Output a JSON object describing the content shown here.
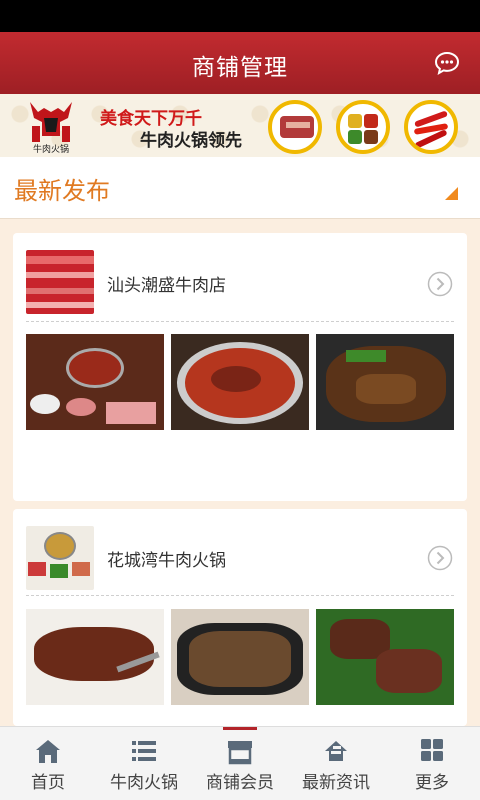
{
  "header": {
    "title": "商铺管理",
    "chat_icon": "chat-bubble-icon"
  },
  "banner": {
    "line1": "美食天下万千",
    "line2": "牛肉火锅领先",
    "logo_text": "牛肉火锅"
  },
  "section": {
    "title": "最新发布"
  },
  "stores": [
    {
      "name": "汕头潮盛牛肉店"
    },
    {
      "name": "花城湾牛肉火锅"
    }
  ],
  "tabbar": {
    "items": [
      {
        "label": "首页",
        "icon": "home-icon"
      },
      {
        "label": "牛肉火锅",
        "icon": "list-icon"
      },
      {
        "label": "商铺会员",
        "icon": "store-icon"
      },
      {
        "label": "最新资讯",
        "icon": "news-icon"
      },
      {
        "label": "更多",
        "icon": "grid-icon"
      }
    ],
    "active_index": 2
  },
  "colors": {
    "primary": "#b3242a",
    "accent": "#e07a22",
    "background": "#fbeee0"
  }
}
